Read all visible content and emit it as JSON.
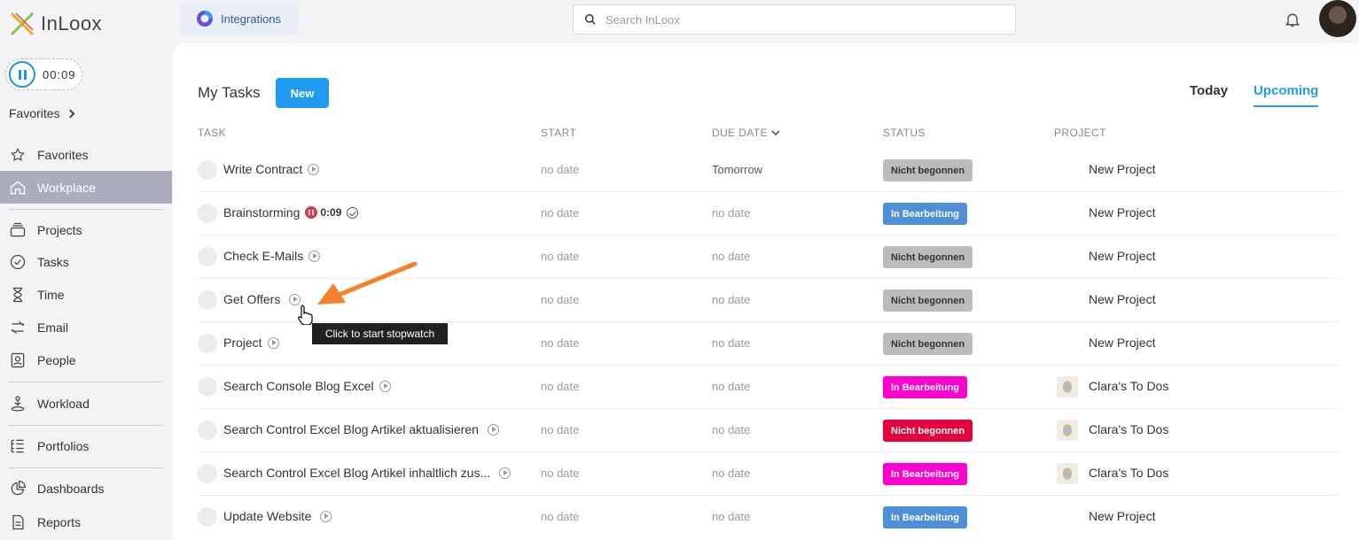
{
  "app": {
    "name": "InLoox"
  },
  "timer": {
    "value": "00:09"
  },
  "sidebar": {
    "favorites_header": "Favorites",
    "items": [
      {
        "label": "Favorites",
        "icon": "star-icon"
      },
      {
        "label": "Workplace",
        "icon": "home-icon",
        "active": true
      },
      {
        "label": "Projects",
        "icon": "projects-icon"
      },
      {
        "label": "Tasks",
        "icon": "tasks-icon"
      },
      {
        "label": "Time",
        "icon": "hourglass-icon"
      },
      {
        "label": "Email",
        "icon": "email-icon"
      },
      {
        "label": "People",
        "icon": "people-icon"
      },
      {
        "label": "Workload",
        "icon": "workload-icon"
      },
      {
        "label": "Portfolios",
        "icon": "portfolios-icon"
      },
      {
        "label": "Dashboards",
        "icon": "dashboards-icon"
      },
      {
        "label": "Reports",
        "icon": "reports-icon"
      }
    ]
  },
  "topbar": {
    "integrations_label": "Integrations",
    "search_placeholder": "Search InLoox"
  },
  "main": {
    "title": "My Tasks",
    "new_label": "New",
    "tabs": [
      {
        "label": "Today",
        "selected": false
      },
      {
        "label": "Upcoming",
        "selected": true
      }
    ],
    "columns": [
      "TASK",
      "START",
      "DUE DATE",
      "STATUS",
      "PROJECT"
    ],
    "tasks": [
      {
        "name": "Write Contract",
        "start": "no date",
        "due": "Tomorrow",
        "status": "Nicht begonnen",
        "status_color": "#bcbcbc",
        "project": "New Project"
      },
      {
        "name": "Brainstorming",
        "timer": "0:09",
        "start": "no date",
        "due": "no date",
        "status": "In Bearbeitung",
        "status_color": "#4f8fd8",
        "project": "New Project"
      },
      {
        "name": "Check E-Mails",
        "start": "no date",
        "due": "no date",
        "status": "Nicht begonnen",
        "status_color": "#bcbcbc",
        "project": "New Project"
      },
      {
        "name": "Get Offers",
        "start": "no date",
        "due": "no date",
        "status": "Nicht begonnen",
        "status_color": "#bcbcbc",
        "project": "New Project"
      },
      {
        "name": "Project",
        "start": "no date",
        "due": "no date",
        "status": "Nicht begonnen",
        "status_color": "#bcbcbc",
        "project": "New Project"
      },
      {
        "name": "Search Console Blog Excel",
        "start": "no date",
        "due": "no date",
        "status": "In Bearbeitung",
        "status_color": "#ff00d0",
        "project": "Clara's To Dos"
      },
      {
        "name": "Search Control Excel Blog Artikel aktualisieren",
        "start": "no date",
        "due": "no date",
        "status": "Nicht begonnen",
        "status_color": "#e3003c",
        "project": "Clara's To Dos"
      },
      {
        "name": "Search Control Excel Blog Artikel inhaltlich zus...",
        "start": "no date",
        "due": "no date",
        "status": "In Bearbeitung",
        "status_color": "#ff00d0",
        "project": "Clara's To Dos"
      },
      {
        "name": "Update Website",
        "start": "no date",
        "due": "no date",
        "status": "In Bearbeitung",
        "status_color": "#4f8fd8",
        "project": "New Project"
      }
    ]
  },
  "tooltip": {
    "text": "Click to start stopwatch"
  },
  "colors": {
    "accent": "#1e9bf0",
    "sidebar_active": "#a9adbd",
    "annotation_arrow": "#f5822a"
  }
}
